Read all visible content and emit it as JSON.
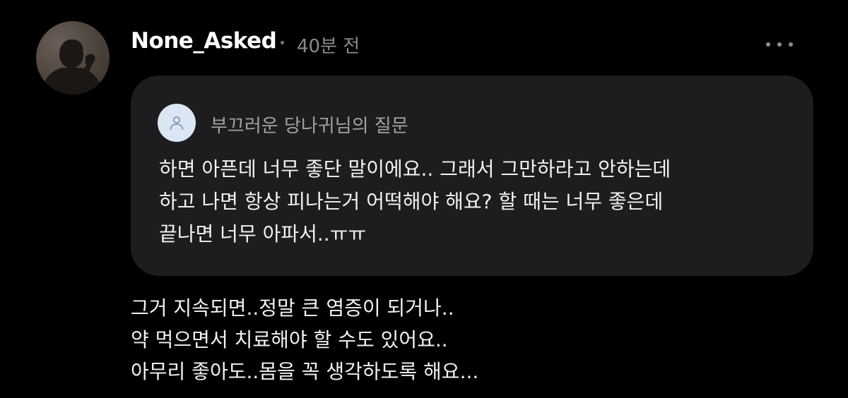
{
  "post": {
    "author": "None_Asked",
    "timestamp": "40분 전",
    "more_icon": "more-horizontal-icon"
  },
  "question": {
    "asker_icon": "user-icon",
    "title": "부끄러운 당나귀님의 질문",
    "lines": [
      "하면 아픈데 너무 좋단 말이에요.. 그래서 그만하라고 안하는데",
      "하고 나면 항상 피나는거 어떡해야 해요? 할 때는 너무 좋은데",
      "끝나면 너무 아파서..ㅠㅠ"
    ]
  },
  "answer": {
    "lines": [
      "그거 지속되면..정말 큰 염증이 되거나..",
      "약 먹으면서 치료해야 할 수도 있어요..",
      "아무리 좋아도..몸을 꼭 생각하도록 해요..."
    ]
  },
  "colors": {
    "background": "#000000",
    "card": "#1d1d1f",
    "text": "#f2f2f2",
    "muted": "#8a8a8a",
    "asker_avatar": "#dbe6f4"
  }
}
